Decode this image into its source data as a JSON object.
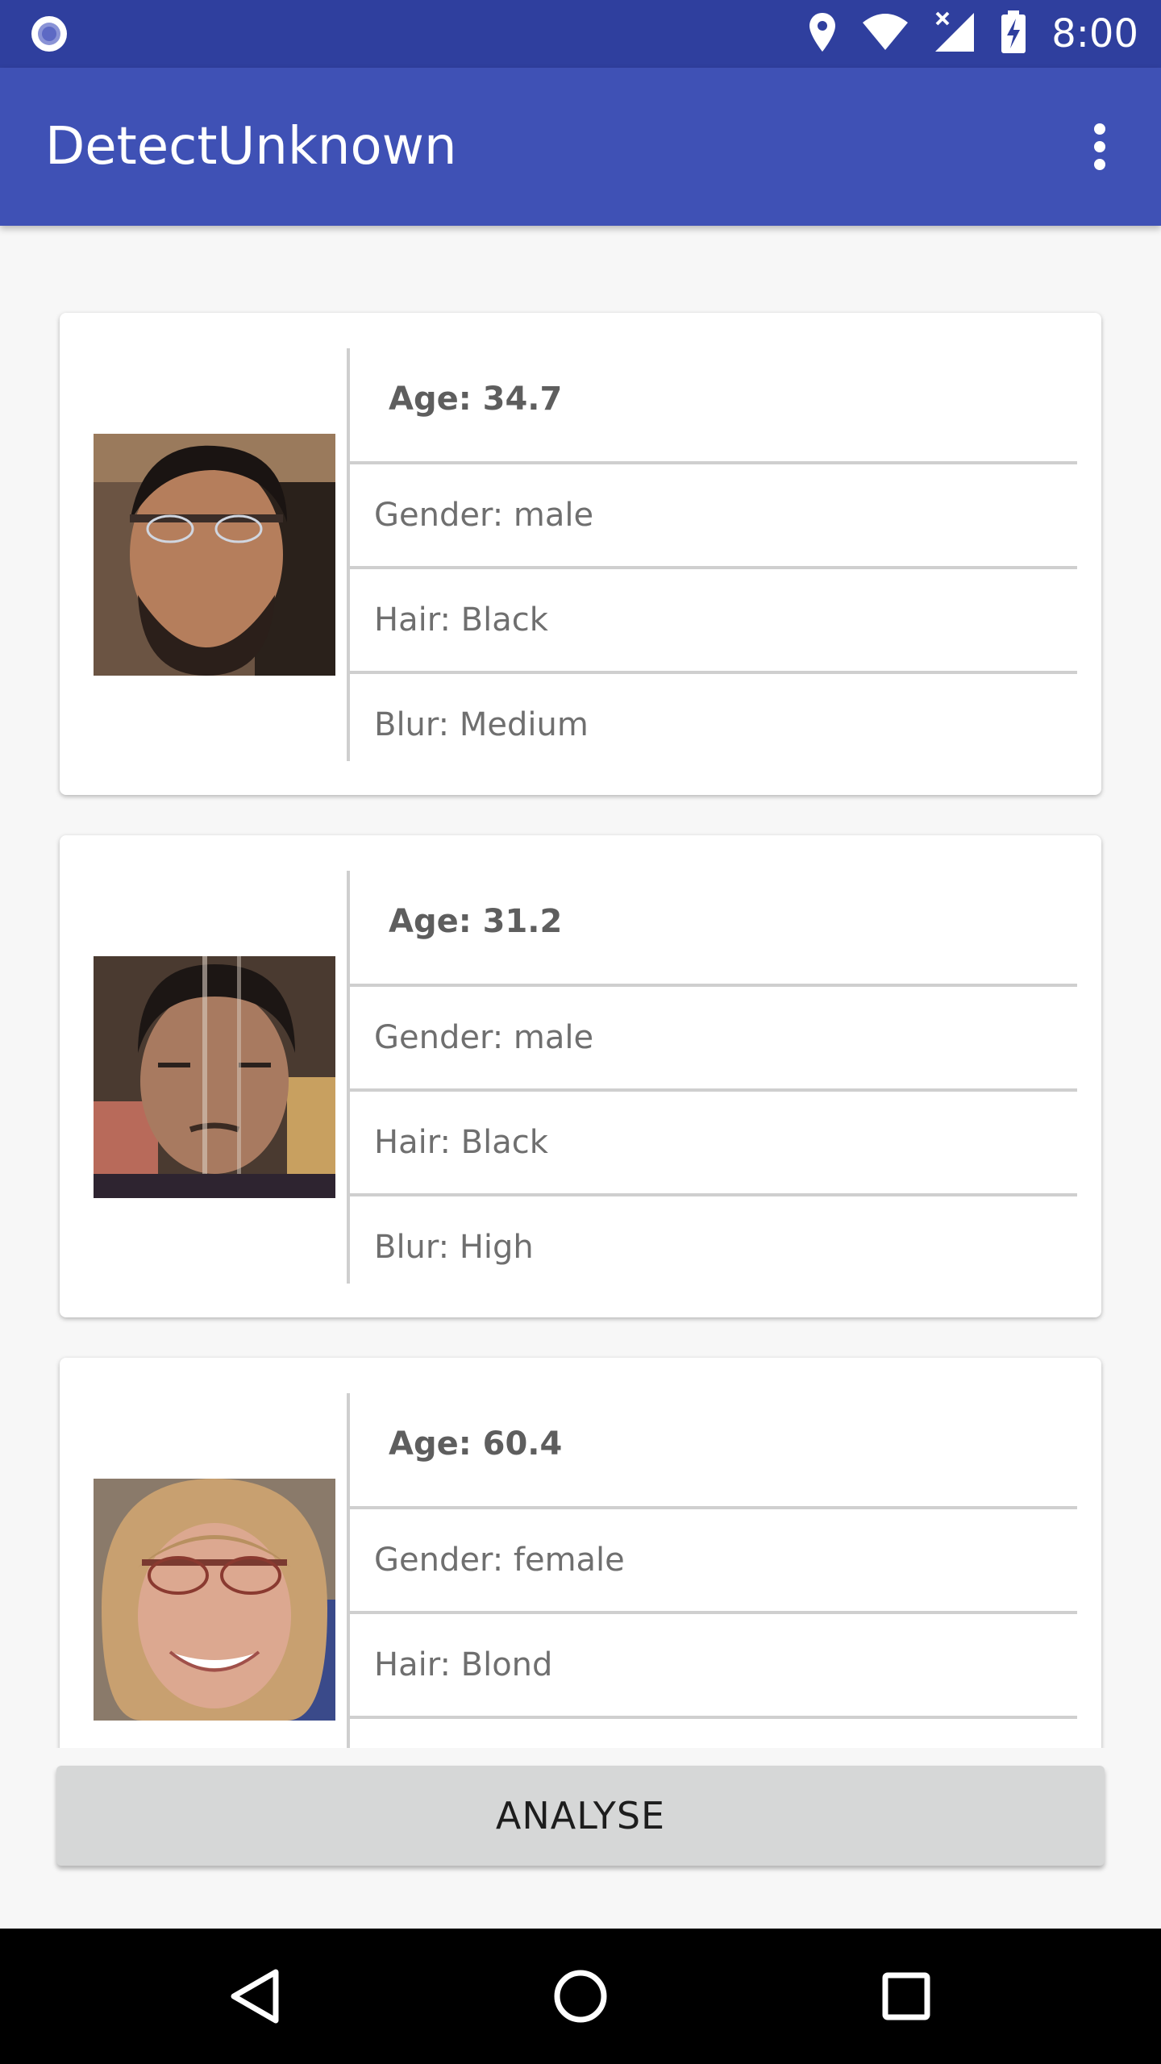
{
  "status_bar": {
    "time": "8:00",
    "icons": [
      "notification-icon",
      "location-icon",
      "wifi-icon",
      "cellular-icon",
      "battery-charging-icon"
    ]
  },
  "app_bar": {
    "title": "DetectUnknown",
    "menu_icon": "overflow-menu-icon"
  },
  "faces": [
    {
      "age": "Age: 34.7",
      "gender": "Gender: male",
      "hair": "Hair: Black",
      "blur": "Blur: Medium"
    },
    {
      "age": "Age: 31.2",
      "gender": "Gender: male",
      "hair": "Hair: Black",
      "blur": "Blur: High"
    },
    {
      "age": "Age: 60.4",
      "gender": "Gender: female",
      "hair": "Hair: Blond"
    }
  ],
  "analyse_button": {
    "label": "ANALYSE"
  },
  "nav_bar": {
    "icons": [
      "back-icon",
      "home-icon",
      "recents-icon"
    ]
  },
  "colors": {
    "status_bar": "#2f3f9e",
    "app_bar": "#3f51b5",
    "background": "#f7f7f7",
    "button": "#d6d7d7"
  }
}
